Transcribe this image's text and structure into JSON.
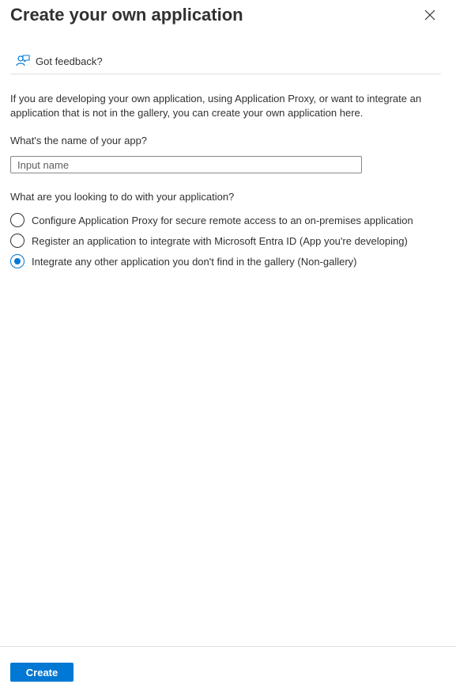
{
  "header": {
    "title": "Create your own application",
    "close_icon": "close-icon"
  },
  "feedback": {
    "label": "Got feedback?",
    "icon": "feedback-person-icon"
  },
  "intro_text": "If you are developing your own application, using Application Proxy, or want to integrate an application that is not in the gallery, you can create your own application here.",
  "name_field": {
    "label": "What's the name of your app?",
    "placeholder": "Input name",
    "value": ""
  },
  "purpose": {
    "label": "What are you looking to do with your application?",
    "options": [
      {
        "label": "Configure Application Proxy for secure remote access to an on-premises application",
        "selected": false
      },
      {
        "label": "Register an application to integrate with Microsoft Entra ID (App you're developing)",
        "selected": false
      },
      {
        "label": "Integrate any other application you don't find in the gallery (Non-gallery)",
        "selected": true
      }
    ]
  },
  "footer": {
    "create_label": "Create"
  },
  "colors": {
    "accent": "#0078d4",
    "text": "#323130",
    "divider": "#e1dfdd"
  }
}
